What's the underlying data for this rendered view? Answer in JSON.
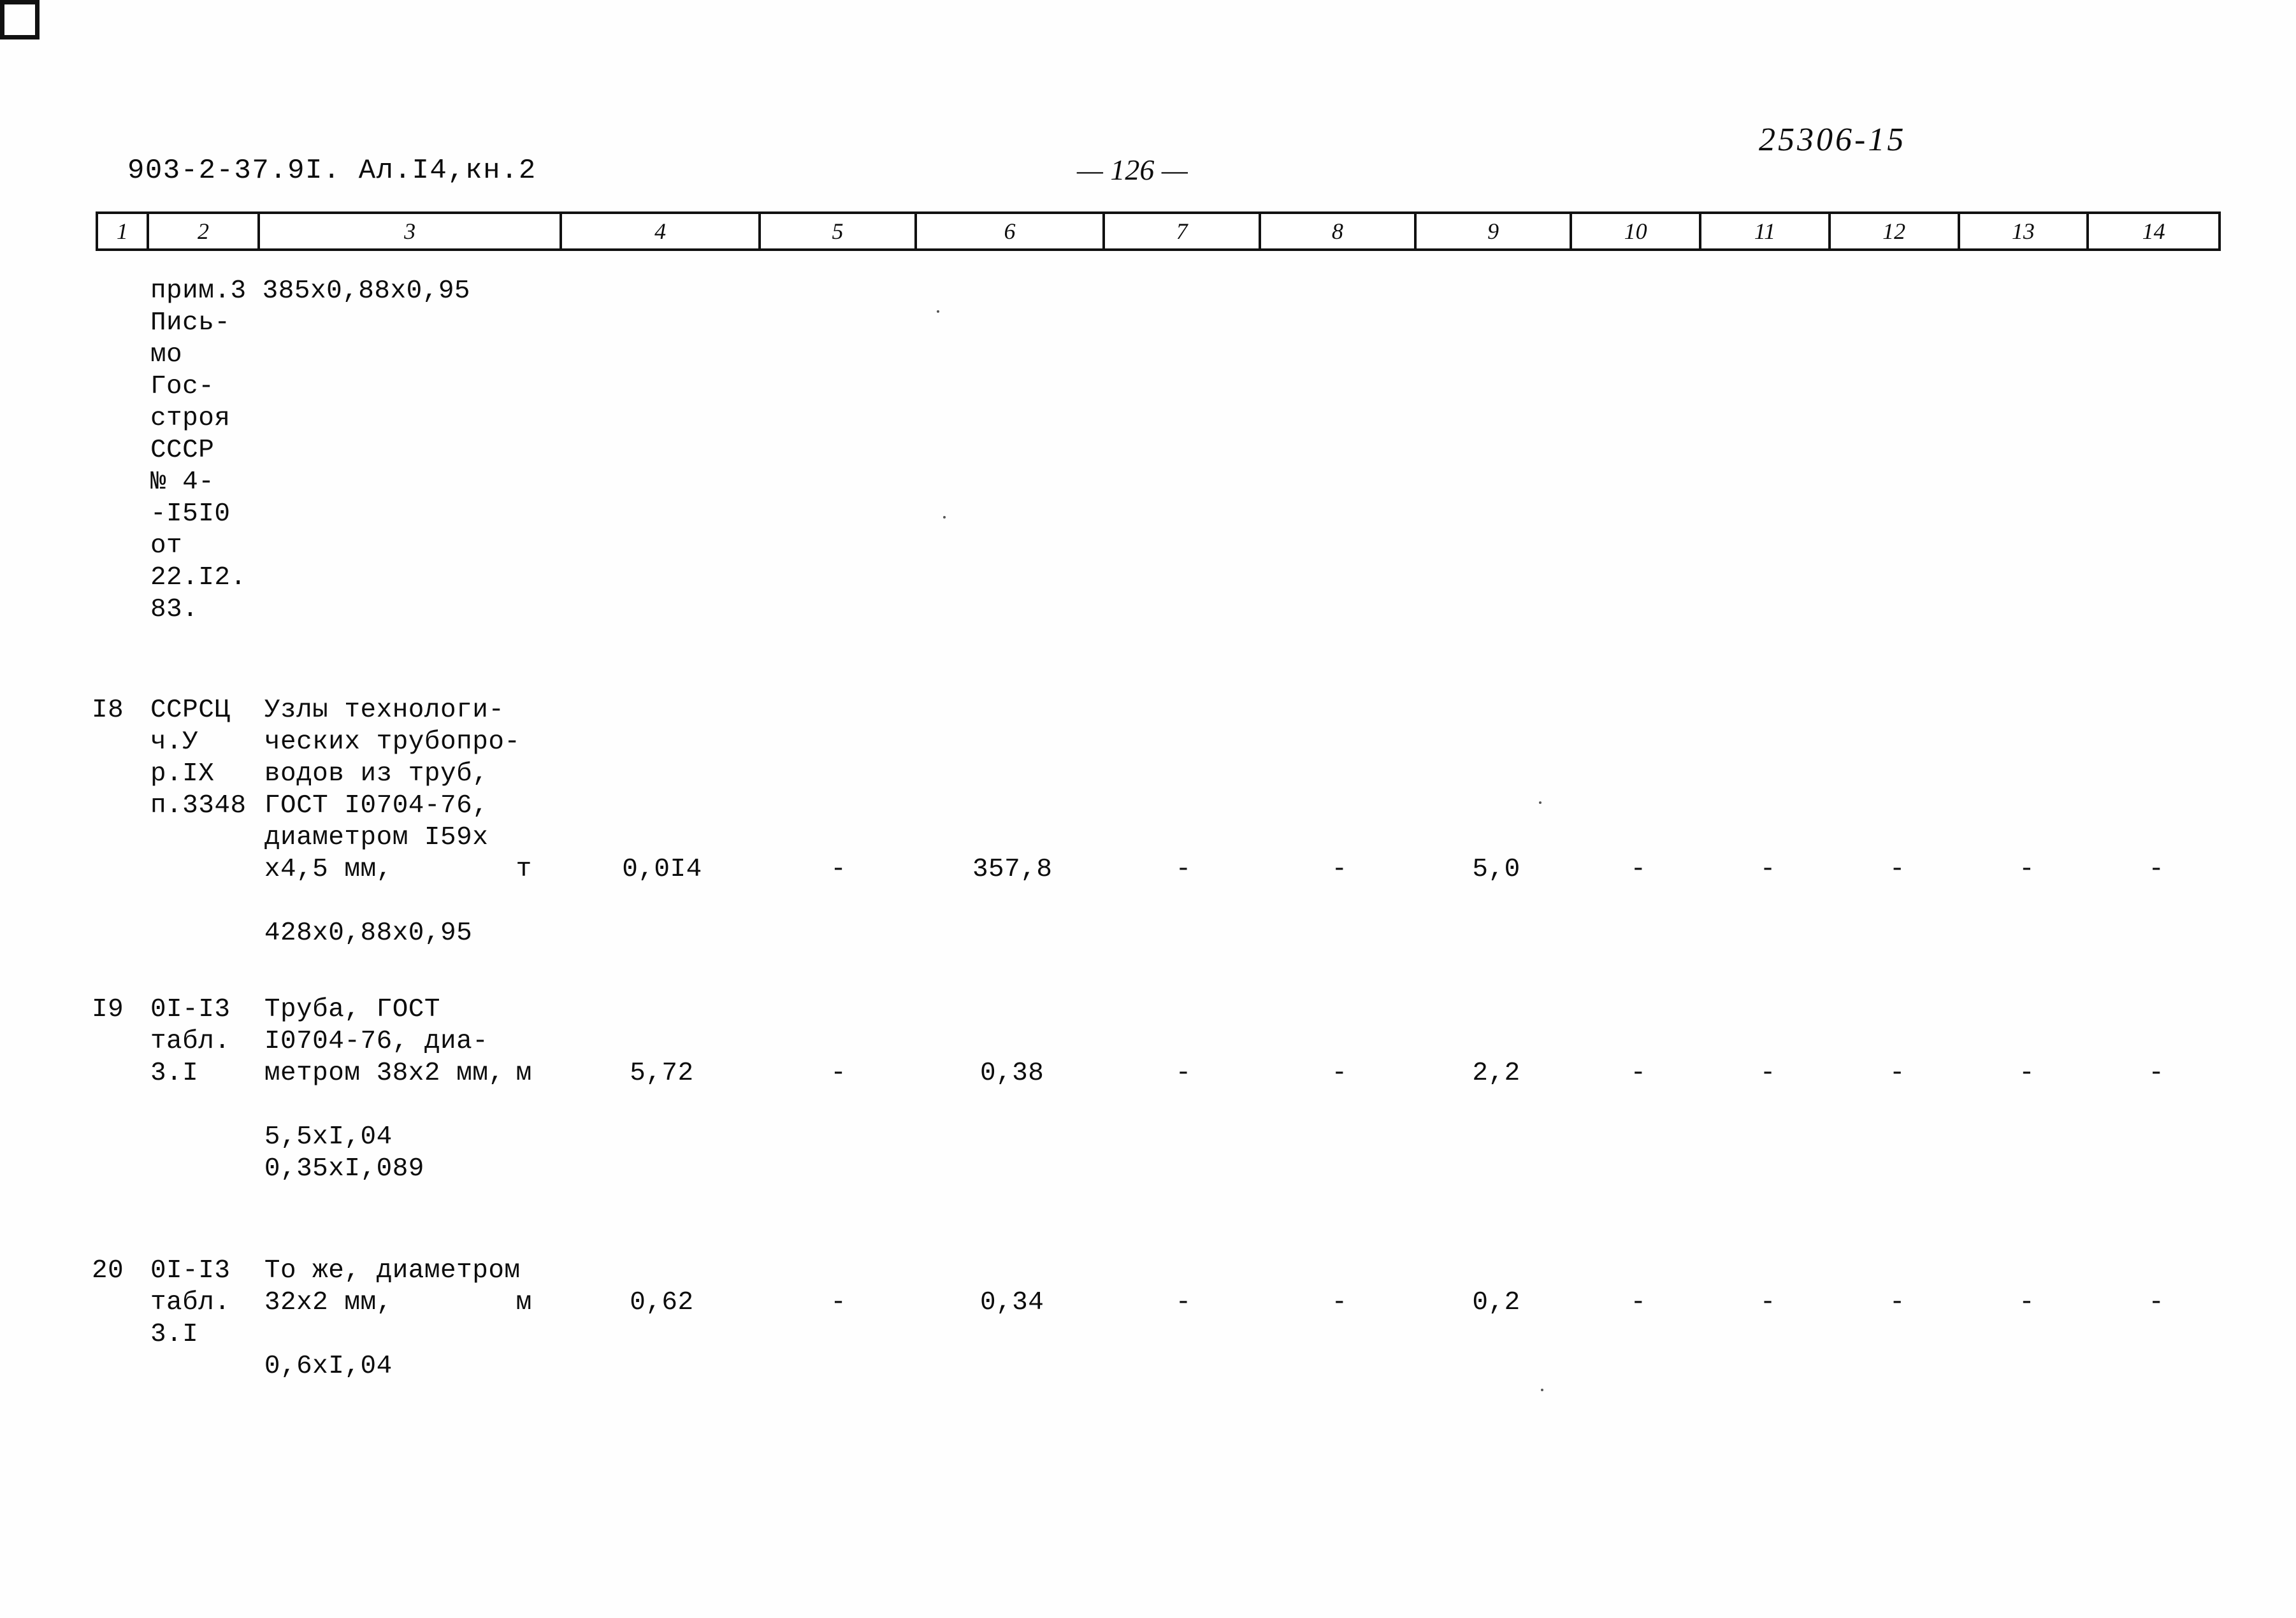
{
  "document": {
    "doc_code": "903-2-37.9I. Ал.I4,кн.2",
    "page_number": "— 126 —",
    "archive_code": "25306-15"
  },
  "table": {
    "column_headers": [
      "1",
      "2",
      "3",
      "4",
      "5",
      "6",
      "7",
      "8",
      "9",
      "10",
      "11",
      "12",
      "13",
      "14"
    ],
    "continuation_block": {
      "lines": [
        "прим.3 385х0,88х0,95",
        "Пись-",
        "мо",
        "Гос-",
        "строя",
        "СССР",
        "№ 4-",
        "-I5I0",
        "от",
        "22.I2.",
        "83."
      ]
    },
    "rows": [
      {
        "no": "I8",
        "code_lines": [
          "ССРСЦ",
          "ч.У",
          "р.IX",
          "п.3348"
        ],
        "name_lines": [
          "Узлы технологи-",
          "ческих трубопро-",
          "водов из труб,",
          "ГОСТ I0704-76,",
          "диаметром I59х",
          "х4,5 мм,"
        ],
        "unit": "т",
        "values": [
          "0,0I4",
          "-",
          "357,8",
          "-",
          "-",
          "5,0",
          "-",
          "-",
          "-",
          "-",
          "-"
        ],
        "note_lines": [
          "428х0,88х0,95"
        ]
      },
      {
        "no": "I9",
        "code_lines": [
          "0I-I3",
          "табл.",
          "3.I"
        ],
        "name_lines": [
          "Труба, ГОСТ",
          "I0704-76, диа-",
          "метром 38х2 мм,"
        ],
        "unit": "м",
        "values": [
          "5,72",
          "-",
          "0,38",
          "-",
          "-",
          "2,2",
          "-",
          "-",
          "-",
          "-",
          "-"
        ],
        "note_lines": [
          "5,5хI,04",
          "0,35хI,089"
        ]
      },
      {
        "no": "20",
        "code_lines": [
          "0I-I3",
          "табл.",
          "3.I"
        ],
        "name_lines": [
          "То же, диаметром",
          "32х2 мм,"
        ],
        "unit": "м",
        "values": [
          "0,62",
          "-",
          "0,34",
          "-",
          "-",
          "0,2",
          "-",
          "-",
          "-",
          "-",
          "-"
        ],
        "note_lines": [
          "0,6хI,04"
        ]
      }
    ]
  }
}
